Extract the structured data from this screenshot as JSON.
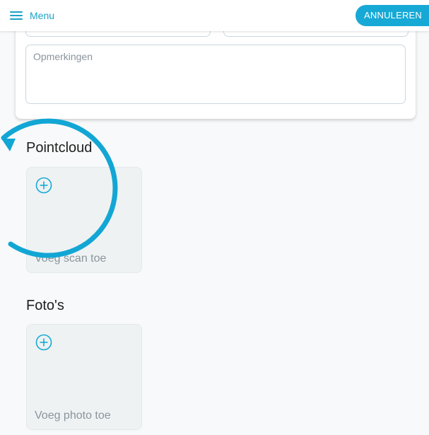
{
  "topbar": {
    "menu_label": "Menu",
    "cancel_label": "ANNULEREN"
  },
  "form": {
    "remarks_placeholder": "Opmerkingen"
  },
  "pointcloud": {
    "title": "Pointcloud",
    "add_label": "Voeg scan toe"
  },
  "photos": {
    "title": "Foto's",
    "add_label": "Voeg photo toe"
  },
  "colors": {
    "accent": "#16a9d6",
    "tutorial_ring": "#12a6d4"
  },
  "icons": {
    "menu": "hamburger-icon",
    "add": "plus-circle-icon",
    "tutorial": "curved-arrow-ring"
  }
}
